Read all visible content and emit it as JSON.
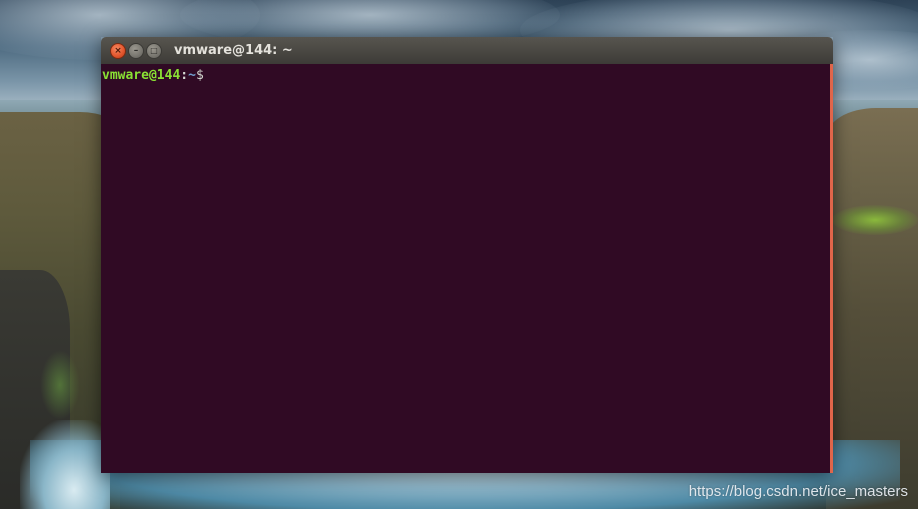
{
  "window": {
    "title": "vmware@144: ~",
    "buttons": {
      "close_icon": "×",
      "minimize_icon": "–",
      "maximize_icon": "□"
    }
  },
  "terminal": {
    "prompt_user_host": "vmware@144",
    "prompt_colon": ":",
    "prompt_path": "~",
    "prompt_symbol": "$"
  },
  "watermark": "https://blog.csdn.net/ice_masters",
  "colors": {
    "terminal_bg": "#300a24",
    "prompt_user": "#8ae234",
    "prompt_path": "#729fcf",
    "close_button": "#e5582f",
    "scrollbar_accent": "#e0654a"
  }
}
